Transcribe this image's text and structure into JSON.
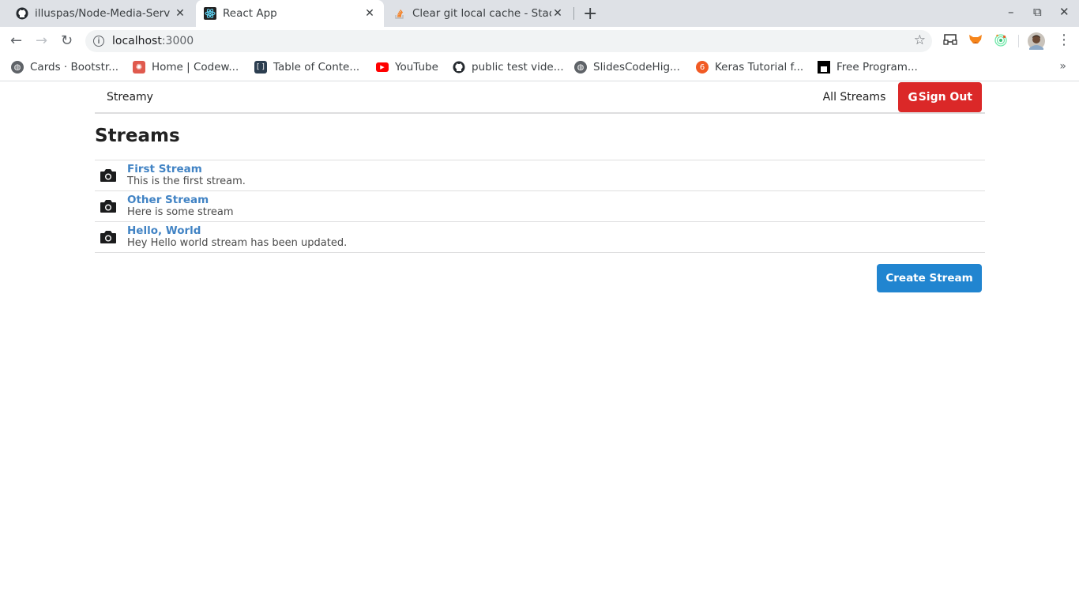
{
  "browser": {
    "tabs": [
      {
        "title": "illuspas/Node-Media-Serv",
        "icon": "github-icon",
        "active": false
      },
      {
        "title": "React App",
        "icon": "react-icon",
        "active": true
      },
      {
        "title": "Clear git local cache - Stac",
        "icon": "stackoverflow-icon",
        "active": false
      }
    ],
    "new_tab": "+",
    "window_controls": {
      "minimize": "–",
      "maximize": "⧉",
      "close": "✕"
    },
    "nav": {
      "back": "←",
      "forward": "→",
      "reload": "↻"
    },
    "address": {
      "host": "localhost",
      "port": ":3000"
    },
    "bookmark_star": "☆",
    "menu_dots": "⋮",
    "bookmarks": [
      {
        "label": "Cards · Bootstr...",
        "icon": "globe-icon"
      },
      {
        "label": "Home | Codew...",
        "icon": "codewars-icon"
      },
      {
        "label": "Table of Conte...",
        "icon": "brackets-icon"
      },
      {
        "label": "YouTube",
        "icon": "youtube-icon"
      },
      {
        "label": "public test vide...",
        "icon": "github-icon"
      },
      {
        "label": "SlidesCodeHig...",
        "icon": "globe-icon"
      },
      {
        "label": "Keras Tutorial f...",
        "icon": "keras-icon"
      },
      {
        "label": "Free Program...",
        "icon": "freecodecamp-icon"
      }
    ],
    "bookmarks_more": "»"
  },
  "app": {
    "brand": "Streamy",
    "nav_all_streams": "All Streams",
    "sign_out": {
      "g": "G",
      "label": "Sign Out"
    },
    "page_title": "Streams",
    "streams": [
      {
        "title": "First Stream",
        "description": "This is the first stream."
      },
      {
        "title": "Other Stream",
        "description": "Here is some stream"
      },
      {
        "title": "Hello, World",
        "description": "Hey Hello world stream has been updated."
      }
    ],
    "create_button": "Create Stream"
  },
  "colors": {
    "sign_out_red": "#db2828",
    "create_blue": "#2185d0",
    "link_blue": "#4183c4"
  }
}
